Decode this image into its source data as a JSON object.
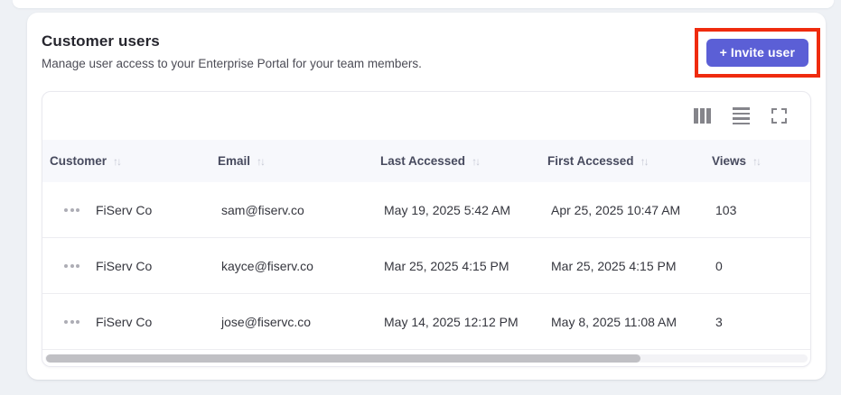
{
  "panel": {
    "title": "Customer users",
    "subtitle": "Manage user access to your Enterprise Portal for your team members.",
    "invite_button_label": "+ Invite user"
  },
  "annotation": {
    "type": "highlight-rectangle",
    "color": "#ef2b0e",
    "target": "invite-user-button"
  },
  "colors": {
    "accent": "#5b5fd6",
    "page_background": "#eef1f5",
    "header_row_background": "#f7f8fc"
  },
  "toolbar": {
    "icons": [
      "columns-icon",
      "density-icon",
      "fullscreen-icon"
    ]
  },
  "table": {
    "sort_glyph": "↑↓",
    "columns": [
      {
        "label": "Customer",
        "sortable": true
      },
      {
        "label": "Email",
        "sortable": true
      },
      {
        "label": "Last Accessed",
        "sortable": true
      },
      {
        "label": "First Accessed",
        "sortable": true
      },
      {
        "label": "Views",
        "sortable": true
      }
    ],
    "rows": [
      {
        "customer": "FiServ Co",
        "email": "sam@fiserv.co",
        "last_accessed": "May 19, 2025 5:42 AM",
        "first_accessed": "Apr 25, 2025 10:47 AM",
        "views": 103
      },
      {
        "customer": "FiServ Co",
        "email": "kayce@fiserv.co",
        "last_accessed": "Mar 25, 2025 4:15 PM",
        "first_accessed": "Mar 25, 2025 4:15 PM",
        "views": 0
      },
      {
        "customer": "FiServ Co",
        "email": "jose@fiservc.co",
        "last_accessed": "May 14, 2025 12:12 PM",
        "first_accessed": "May 8, 2025 11:08 AM",
        "views": 3
      }
    ],
    "horizontal_scrollbar": {
      "visible": true,
      "thumb_percent": 78
    }
  }
}
